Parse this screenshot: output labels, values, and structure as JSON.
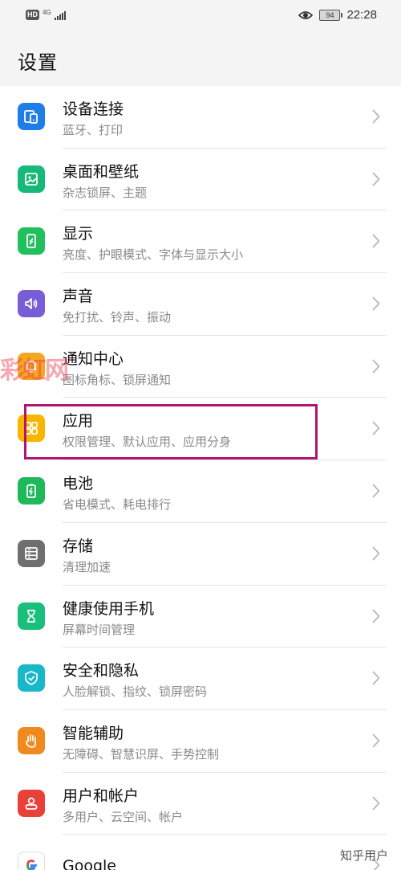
{
  "status_bar": {
    "hd": "HD",
    "network": "4G",
    "battery": "94",
    "time": "22:28"
  },
  "header": {
    "title": "设置"
  },
  "settings_items": [
    {
      "title": "设备连接",
      "subtitle": "蓝牙、打印",
      "color": "#1e7de6",
      "icon": "devices-icon"
    },
    {
      "title": "桌面和壁纸",
      "subtitle": "杂志锁屏、主题",
      "color": "#17b978",
      "icon": "wallpaper-icon"
    },
    {
      "title": "显示",
      "subtitle": "亮度、护眼模式、字体与显示大小",
      "color": "#20c05c",
      "icon": "display-icon"
    },
    {
      "title": "声音",
      "subtitle": "免打扰、铃声、振动",
      "color": "#7a5cd6",
      "icon": "sound-icon"
    },
    {
      "title": "通知中心",
      "subtitle": "图标角标、锁屏通知",
      "color": "#f5a623",
      "icon": "notification-icon"
    },
    {
      "title": "应用",
      "subtitle": "权限管理、默认应用、应用分身",
      "color": "#f7b500",
      "icon": "apps-icon"
    },
    {
      "title": "电池",
      "subtitle": "省电模式、耗电排行",
      "color": "#1fb85a",
      "icon": "battery-icon"
    },
    {
      "title": "存储",
      "subtitle": "清理加速",
      "color": "#6f6f6f",
      "icon": "storage-icon"
    },
    {
      "title": "健康使用手机",
      "subtitle": "屏幕时间管理",
      "color": "#19bf7a",
      "icon": "hourglass-icon"
    },
    {
      "title": "安全和隐私",
      "subtitle": "人脸解锁、指纹、锁屏密码",
      "color": "#19b8c8",
      "icon": "shield-icon"
    },
    {
      "title": "智能辅助",
      "subtitle": "无障碍、智慧识屏、手势控制",
      "color": "#f08a1e",
      "icon": "hand-icon"
    },
    {
      "title": "用户和帐户",
      "subtitle": "多用户、云空间、帐户",
      "color": "#e8413a",
      "icon": "user-icon"
    },
    {
      "title": "Google",
      "subtitle": "",
      "color": "#ffffff",
      "icon": "google-icon"
    }
  ],
  "watermark": "彩虹网",
  "source_mark": "知乎用户"
}
